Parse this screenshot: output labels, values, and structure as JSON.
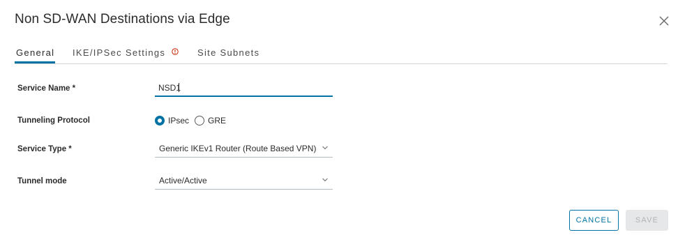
{
  "dialog": {
    "title": "Non SD-WAN Destinations via Edge"
  },
  "tabs": [
    {
      "label": "General",
      "active": true
    },
    {
      "label": "IKE/IPSec Settings",
      "active": false,
      "warning_icon": "exclamation-circle-icon"
    },
    {
      "label": "Site Subnets",
      "active": false
    }
  ],
  "form": {
    "service_name": {
      "label": "Service Name *",
      "value": "NSD1"
    },
    "tunneling_protocol": {
      "label": "Tunneling Protocol",
      "options": [
        {
          "label": "IPsec",
          "selected": true
        },
        {
          "label": "GRE",
          "selected": false
        }
      ]
    },
    "service_type": {
      "label": "Service Type *",
      "value": "Generic IKEv1 Router (Route Based VPN)"
    },
    "tunnel_mode": {
      "label": "Tunnel mode",
      "value": "Active/Active"
    }
  },
  "buttons": {
    "cancel": "CANCEL",
    "save": "SAVE"
  },
  "colors": {
    "accent": "#0072a3",
    "warning": "#c92100",
    "disabled_bg": "#e6e7e8"
  }
}
